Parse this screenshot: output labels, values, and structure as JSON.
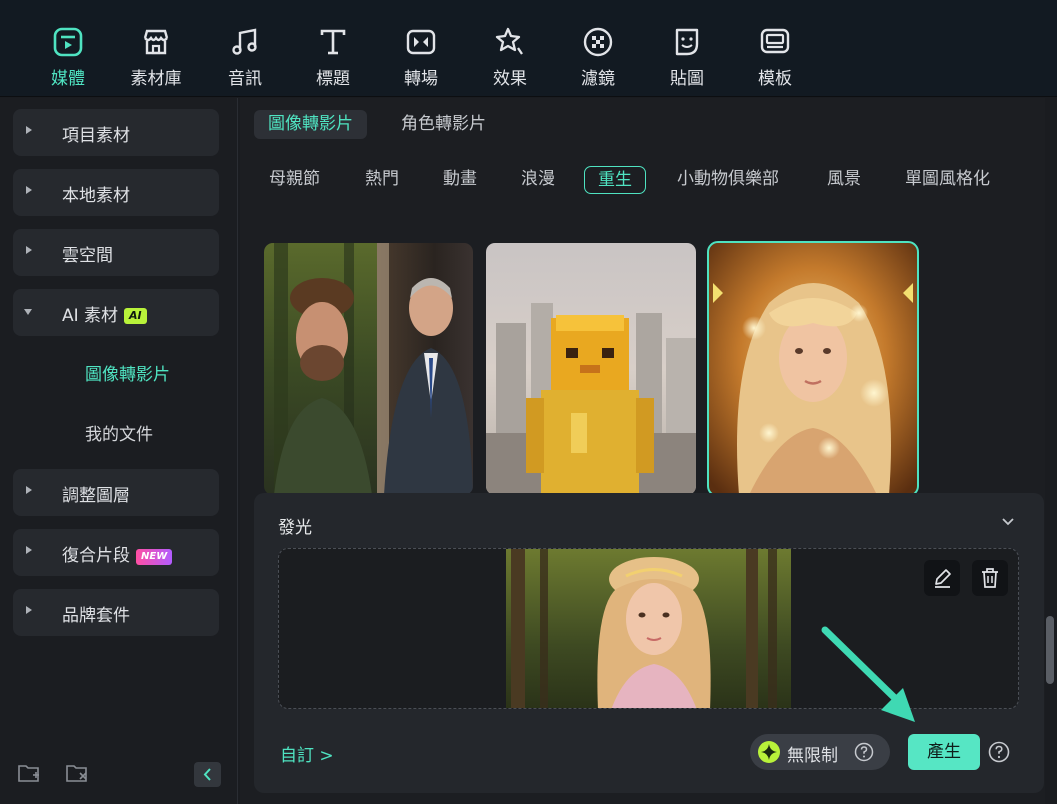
{
  "toolbar": {
    "tools": [
      {
        "label": "媒體",
        "icon": "media-icon",
        "active": true
      },
      {
        "label": "素材庫",
        "icon": "store-icon"
      },
      {
        "label": "音訊",
        "icon": "music-note-icon"
      },
      {
        "label": "標題",
        "icon": "text-t-icon"
      },
      {
        "label": "轉場",
        "icon": "transition-icon"
      },
      {
        "label": "效果",
        "icon": "effects-star-icon"
      },
      {
        "label": "濾鏡",
        "icon": "filter-icon"
      },
      {
        "label": "貼圖",
        "icon": "sticker-icon"
      },
      {
        "label": "模板",
        "icon": "template-icon"
      }
    ],
    "accent_color": "#4fe3c1"
  },
  "sidebar": {
    "items": [
      {
        "label": "項目素材",
        "expanded": false
      },
      {
        "label": "本地素材",
        "expanded": false
      },
      {
        "label": "雲空間",
        "expanded": false
      },
      {
        "label": "AI 素材",
        "expanded": true,
        "badge": "AI"
      },
      {
        "label": "調整圖層",
        "expanded": false
      },
      {
        "label": "復合片段",
        "expanded": false,
        "badge": "NEW"
      },
      {
        "label": "品牌套件",
        "expanded": false
      }
    ],
    "sub_items": [
      {
        "label": "圖像轉影片",
        "active": true
      },
      {
        "label": "我的文件",
        "active": false
      }
    ]
  },
  "main": {
    "top_tabs": [
      {
        "label": "圖像轉影片",
        "active": true
      },
      {
        "label": "角色轉影片",
        "active": false
      }
    ],
    "categories": [
      {
        "label": "母親節"
      },
      {
        "label": "熱門"
      },
      {
        "label": "動畫"
      },
      {
        "label": "浪漫"
      },
      {
        "label": "重生",
        "active": true
      },
      {
        "label": "小動物俱樂部"
      },
      {
        "label": "風景"
      },
      {
        "label": "單圖風格化"
      }
    ],
    "thumbnails": [
      {
        "name": "men-portrait-thumbnail"
      },
      {
        "name": "pixel-character-thumbnail"
      },
      {
        "name": "glowing-girl-thumbnail",
        "selected": true
      }
    ]
  },
  "panel": {
    "title": "發光",
    "custom_link": "自訂 >",
    "unlimited_label": "無限制",
    "generate_label": "產生"
  }
}
